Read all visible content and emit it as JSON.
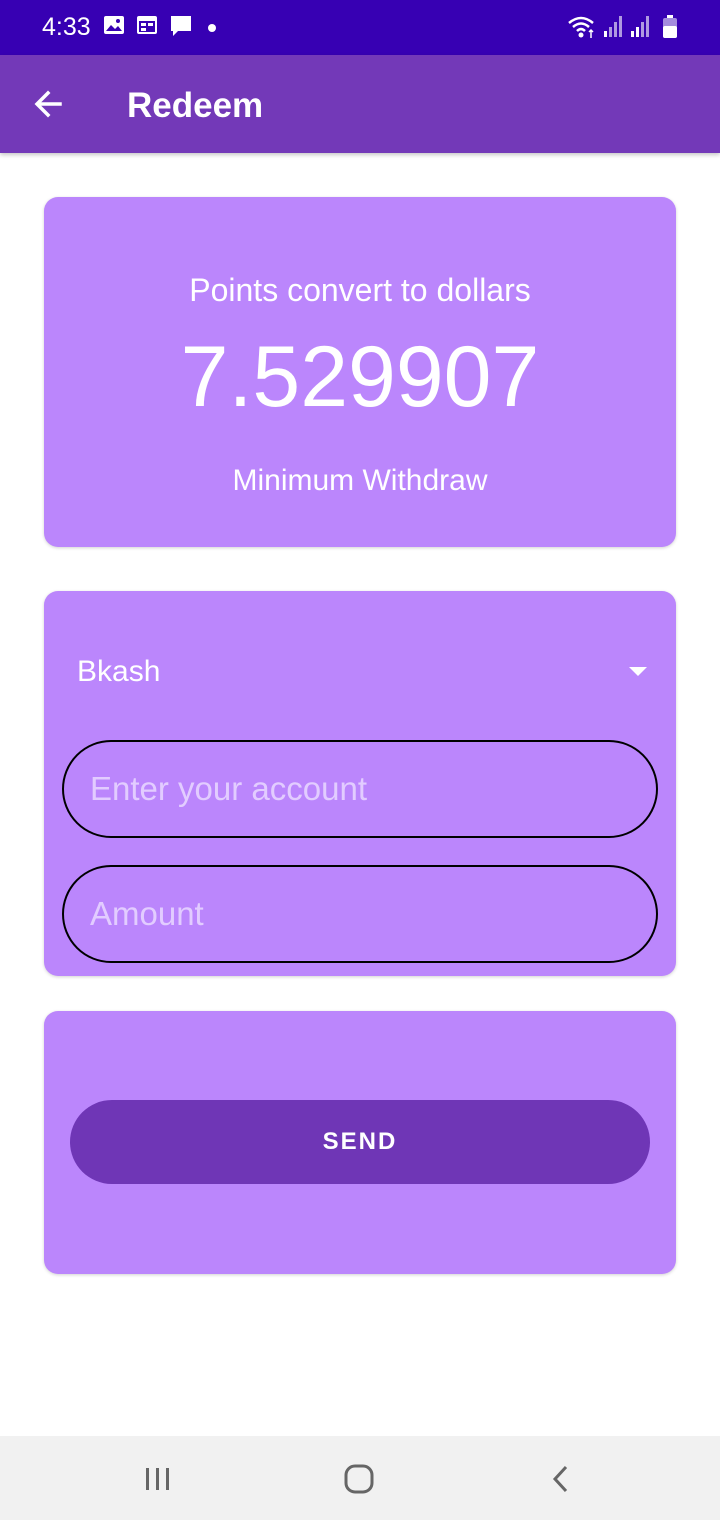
{
  "status_bar": {
    "time": "4:33",
    "icons": [
      "image-icon",
      "calendar-icon",
      "message-icon",
      "dot-icon",
      "wifi-icon",
      "signal-icon",
      "signal-icon",
      "battery-icon"
    ]
  },
  "app_bar": {
    "title": "Redeem",
    "back_icon": "arrow-back-icon"
  },
  "points_card": {
    "label": "Points convert to dollars",
    "value": "7.529907",
    "minimum_label": "Minimum Withdraw"
  },
  "form": {
    "method_selected": "Bkash",
    "account_placeholder": "Enter your account",
    "account_value": "",
    "amount_placeholder": "Amount",
    "amount_value": ""
  },
  "actions": {
    "send_label": "SEND"
  },
  "nav_bar": {
    "icons": [
      "recent-apps-icon",
      "home-icon",
      "back-icon"
    ]
  },
  "colors": {
    "status_bar": "#3700b3",
    "app_bar": "#7339b8",
    "card": "#bb86fc",
    "button": "#6f36b6"
  }
}
